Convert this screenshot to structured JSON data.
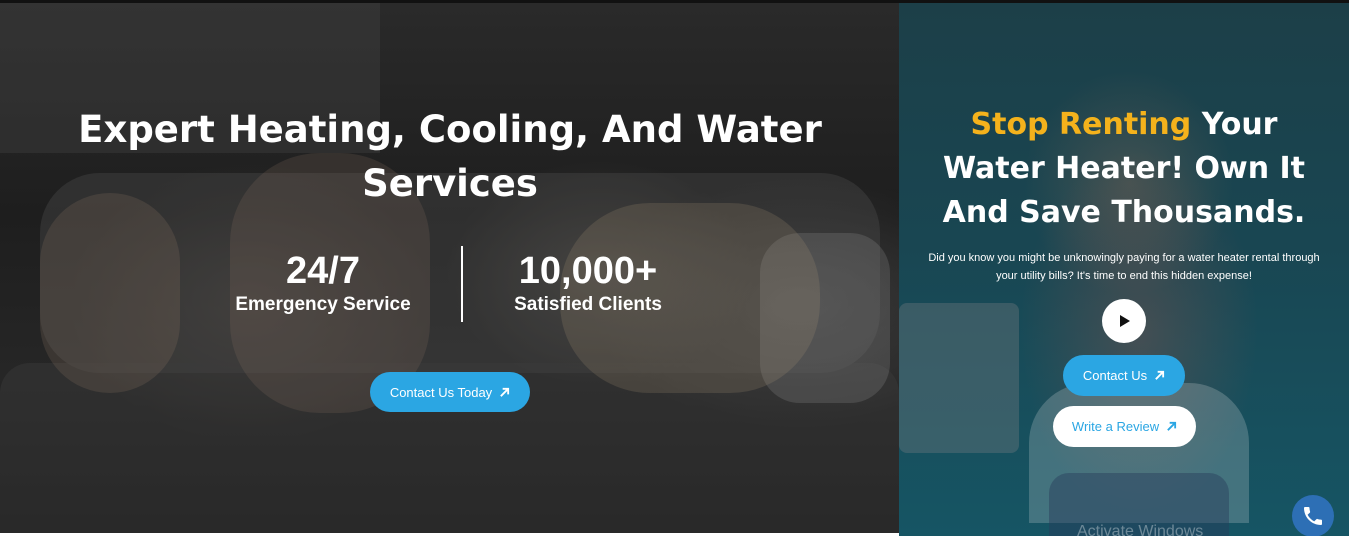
{
  "hero": {
    "title": "Expert Heating, Cooling, And Water Services",
    "stats": [
      {
        "value": "24/7",
        "label": "Emergency Service"
      },
      {
        "value": "10,000+",
        "label": "Satisfied Clients"
      }
    ],
    "cta_label": "Contact Us Today",
    "cta_icon": "arrow-up-right-icon"
  },
  "promo": {
    "title_accent": "Stop Renting",
    "title_rest": "Your Water Heater! Own It And Save Thousands.",
    "text": "Did you know you might be unknowingly paying for a water heater rental through your utility bills? It's time to end this hidden expense!",
    "play_icon": "play-icon",
    "contact_label": "Contact Us",
    "review_label": "Write a Review"
  },
  "watermark": "Activate Windows",
  "phone_icon": "phone-icon",
  "colors": {
    "accent_blue": "#2ba6e3",
    "accent_yellow": "#f4b21c",
    "panel_teal": "#194652",
    "fab_blue": "#2d6fb5"
  }
}
